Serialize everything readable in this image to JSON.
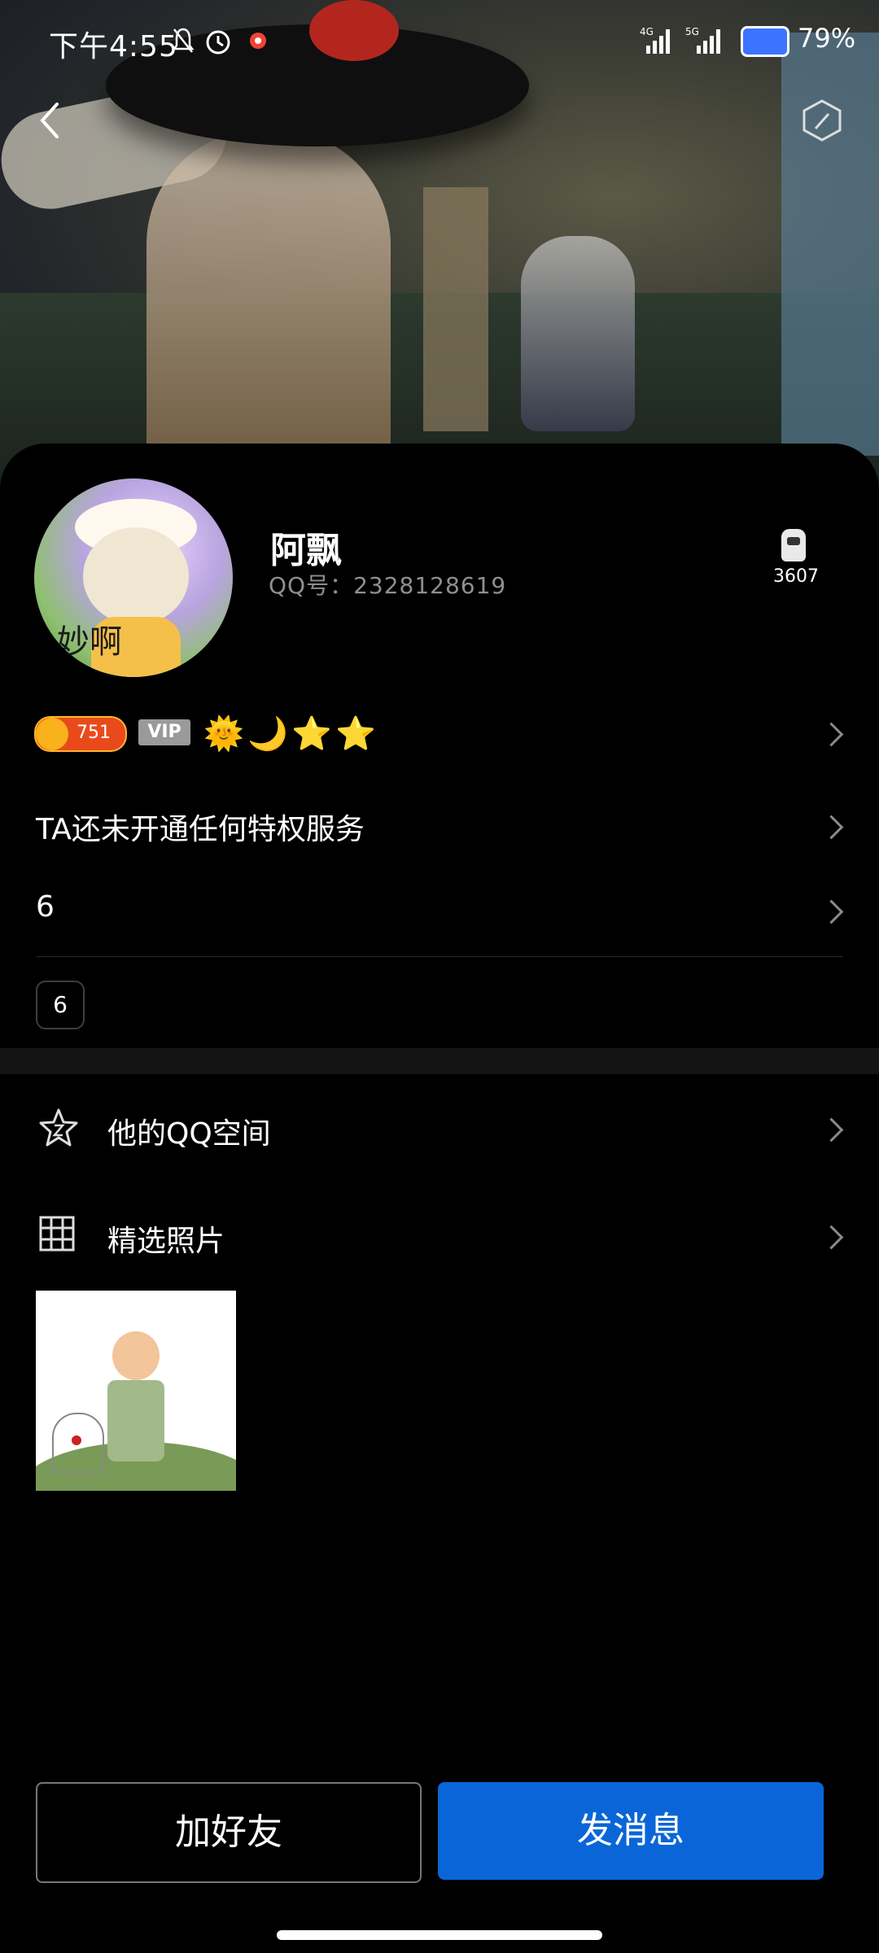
{
  "status_bar": {
    "time": "下午4:55",
    "network_1": "4G",
    "network_2": "5G",
    "battery_percent": "79%"
  },
  "header": {
    "back_icon": "chevron-left-icon",
    "settings_icon": "hexagon-icon"
  },
  "profile": {
    "name": "阿飘",
    "qq_label": "QQ号：2328128619",
    "avatar_text": "妙啊",
    "visitor_count": "3607"
  },
  "level": {
    "coin_value": "751",
    "vip_label": "VIP",
    "badges": [
      "sun",
      "moon",
      "star",
      "star"
    ]
  },
  "rows": {
    "privilege_text": "TA还未开通任何特权服务",
    "signature": "6",
    "tag": "6"
  },
  "menu": {
    "qzone_label": "他的QQ空间",
    "photos_label": "精选照片"
  },
  "actions": {
    "add_friend": "加好友",
    "send_message": "发消息"
  },
  "colors": {
    "primary_button": "#0a66d8",
    "background": "#000000"
  }
}
